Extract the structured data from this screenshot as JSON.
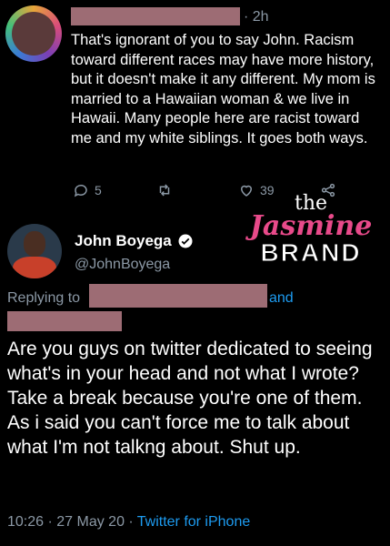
{
  "reply": {
    "time": "· 2h",
    "text": "That's ignorant of you to say John. Racism toward different races may have more history, but it doesn't make it any different. My mom is married to a Hawaiian woman & we live in Hawaii. Many people here are racist toward me and my white siblings. It goes both ways.",
    "reply_count": "5",
    "like_count": "39"
  },
  "watermark": {
    "line1": "the",
    "line2": "Jasmine",
    "line3": "BRAND"
  },
  "tweet": {
    "name": "John Boyega",
    "handle": "@JohnBoyega",
    "replying_label": "Replying to",
    "and_label": "and",
    "text": "Are you guys on twitter dedicated to seeing what's in your head and not what I wrote? Take a break because you're one of them. As i said you can't force me to talk about what I'm not talkng about. Shut up.",
    "timestamp": "10:26 · 27 May 20 ·",
    "source": "Twitter for iPhone"
  },
  "colors": {
    "background": "#000000",
    "accent": "#1d9bf0",
    "muted": "#8b98a5",
    "redaction": "#b97f88",
    "brand_pink": "#e84a8a"
  }
}
